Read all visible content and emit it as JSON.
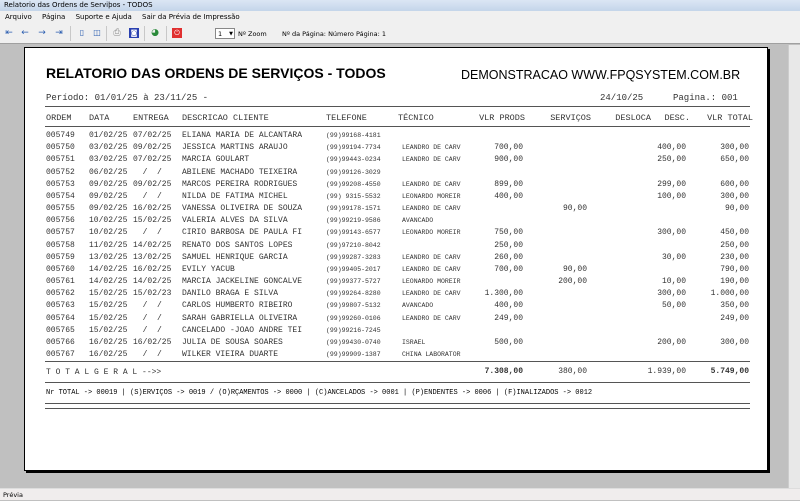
{
  "window": {
    "title": "Relatorio das Ordens de Serviþos  - TODOS"
  },
  "menu": [
    "Arquivo",
    "Página",
    "Suporte e Ajuda",
    "Sair da Prévia de Impressão"
  ],
  "toolbar": {
    "zoom_value": "1",
    "zoom_label": "Nº Zoom",
    "page_label": "Nº da Página: Número Página: 1",
    "icons": [
      "first-page-icon",
      "prev-page-icon",
      "next-page-icon",
      "last-page-icon",
      "single-page-icon",
      "two-page-icon",
      "print-icon",
      "export-icon",
      "web-icon",
      "close-icon"
    ]
  },
  "report": {
    "title": "RELATORIO DAS ORDENS DE SERVIÇOS  - TODOS",
    "watermark": "DEMONSTRACAO WWW.FPQSYSTEM.COM.BR",
    "period": "Período: 01/01/25 à 23/11/25 -",
    "date": "24/10/25",
    "page": "Pagina.: 001",
    "columns": [
      "ORDEM",
      "DATA",
      "ENTREGA",
      "DESCRICAO CLIENTE",
      "TELEFONE",
      "TÉCNICO",
      "VLR PRODS",
      "SERVIÇOS",
      "DESLOCA",
      "DESC.",
      "VLR TOTAL"
    ],
    "rows": [
      [
        "005749",
        "01/02/25",
        "07/02/25",
        "ELIANA MARIA DE ALCANTARA",
        "(99)99168-4181",
        "",
        "",
        "",
        "",
        "",
        ""
      ],
      [
        "005750",
        "03/02/25",
        "09/02/25",
        "JESSICA MARTINS ARAUJO",
        "(99)99194-7734",
        "LEANDRO DE CARV",
        "700,00",
        "",
        "",
        "400,00",
        "300,00"
      ],
      [
        "005751",
        "03/02/25",
        "07/02/25",
        "MARCIA GOULART",
        "(99)99443-0234",
        "LEANDRO DE CARV",
        "900,00",
        "",
        "",
        "250,00",
        "650,00"
      ],
      [
        "005752",
        "06/02/25",
        "  /  /",
        "ABILENE MACHADO TEIXEIRA",
        "(99)99126-3029",
        "",
        "",
        "",
        "",
        "",
        ""
      ],
      [
        "005753",
        "09/02/25",
        "09/02/25",
        "MARCOS PEREIRA RODRIGUES",
        "(99)99208-4550",
        "LEANDRO DE CARV",
        "899,00",
        "",
        "",
        "299,00",
        "600,00"
      ],
      [
        "005754",
        "09/02/25",
        "  /  /",
        "NILDA DE FATIMA MICHEL",
        "(99) 9315-5532",
        "LEONARDO MOREIR",
        "400,00",
        "",
        "",
        "100,00",
        "300,00"
      ],
      [
        "005755",
        "09/02/25",
        "16/02/25",
        "VANESSA OLIVEIRA DE SOUZA",
        "(99)99178-1571",
        "LEANDRO DE CARV",
        "",
        "90,00",
        "",
        "",
        "90,00"
      ],
      [
        "005756",
        "10/02/25",
        "15/02/25",
        "VALERIA ALVES DA SILVA",
        "(99)99219-9586",
        "AVANCADO",
        "",
        "",
        "",
        "",
        ""
      ],
      [
        "005757",
        "10/02/25",
        "  /  /",
        "CIRIO BARBOSA DE PAULA FI",
        "(99)99143-6577",
        "LEONARDO MOREIR",
        "750,00",
        "",
        "",
        "300,00",
        "450,00"
      ],
      [
        "005758",
        "11/02/25",
        "14/02/25",
        "RENATO DOS SANTOS LOPES",
        "(99)97210-8042",
        "",
        "250,00",
        "",
        "",
        "",
        "250,00"
      ],
      [
        "005759",
        "13/02/25",
        "13/02/25",
        "SAMUEL HENRIQUE GARCIA",
        "(99)99287-3283",
        "LEANDRO DE CARV",
        "260,00",
        "",
        "",
        "30,00",
        "230,00"
      ],
      [
        "005760",
        "14/02/25",
        "16/02/25",
        "EVILY YACUB",
        "(99)99405-2017",
        "LEANDRO DE CARV",
        "700,00",
        "90,00",
        "",
        "",
        "790,00"
      ],
      [
        "005761",
        "14/02/25",
        "14/02/25",
        "MARCIA JACKELINE GONCALVE",
        "(99)99377-5727",
        "LEONARDO MOREIR",
        "",
        "200,00",
        "",
        "10,00",
        "190,00"
      ],
      [
        "005762",
        "15/02/25",
        "15/02/23",
        "DANILO BRAGA E SILVA",
        "(99)99264-8280",
        "LEANDRO DE CARV",
        "1.300,00",
        "",
        "",
        "300,00",
        "1.000,00"
      ],
      [
        "005763",
        "15/02/25",
        "  /  /",
        "CARLOS HUMBERTO RIBEIRO",
        "(99)99807-5132",
        "AVANCADO",
        "400,00",
        "",
        "",
        "50,00",
        "350,00"
      ],
      [
        "005764",
        "15/02/25",
        "  /  /",
        "SARAH GABRIELLA OLIVEIRA",
        "(99)99260-0106",
        "LEANDRO DE CARV",
        "249,00",
        "",
        "",
        "",
        "249,00"
      ],
      [
        "005765",
        "15/02/25",
        "  /  /",
        "CANCELADO -JOAO ANDRE TEI",
        "(99)99216-7245",
        "",
        "",
        "",
        "",
        "",
        ""
      ],
      [
        "005766",
        "16/02/25",
        "16/02/25",
        "JULIA DE SOUSA SOARES",
        "(99)99430-0740",
        "ISRAEL",
        "500,00",
        "",
        "",
        "200,00",
        "300,00"
      ],
      [
        "005767",
        "16/02/25",
        "  /  /",
        "WILKER VIEIRA DUARTE",
        "(99)99909-1387",
        "CHINA LABORATOR",
        "",
        "",
        "",
        "",
        ""
      ]
    ],
    "total": {
      "label": "T O T A L   G E R A L   -->>",
      "prods": "7.308,00",
      "servicos": "380,00",
      "desc": "1.939,00",
      "total": "5.749,00"
    },
    "summary": "Nr TOTAL -> 00019 | (S)ERVIÇOS -> 0019 / (O)RÇAMENTOS -> 0000 | (C)ANCELADOS -> 0001 | (P)ENDENTES -> 0006 | (F)INALIZADOS -> 0012"
  },
  "status": {
    "text": "Prévia"
  }
}
